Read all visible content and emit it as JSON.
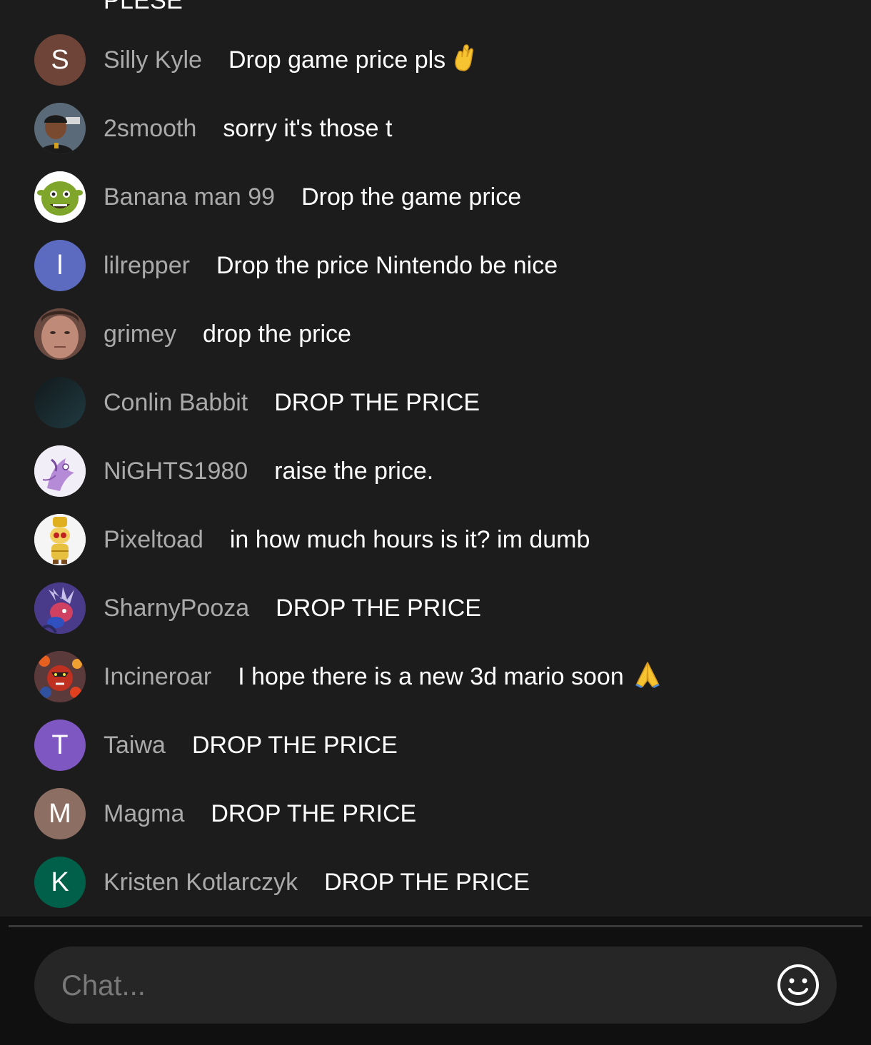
{
  "partial_top_message": "PLESE",
  "messages": [
    {
      "author": "Silly Kyle",
      "text": "Drop game price pls",
      "emoji": "crossed-fingers-icon",
      "avatar_letter": "S",
      "avatar_color": "#6d4437"
    },
    {
      "author": "2smooth",
      "text": "sorry it's those t",
      "avatar_letter": "",
      "avatar_color": "#3d3d3d"
    },
    {
      "author": "Banana man 99",
      "text": "Drop the game price",
      "avatar_letter": "",
      "avatar_color": "#6a8d1e"
    },
    {
      "author": "lilrepper",
      "text": "Drop the price Nintendo be nice",
      "avatar_letter": "l",
      "avatar_color": "#5c6bc0"
    },
    {
      "author": "grimey",
      "text": "drop the price",
      "avatar_letter": "",
      "avatar_color": "#9c6a5a"
    },
    {
      "author": "Conlin Babbit",
      "text": "DROP THE PRICE",
      "avatar_letter": "",
      "avatar_color": "#1b2b30"
    },
    {
      "author": "NiGHTS1980",
      "text": "raise the price.",
      "avatar_letter": "",
      "avatar_color": "#f2eef8"
    },
    {
      "author": "Pixeltoad",
      "text": "in how much hours is it? im dumb",
      "avatar_letter": "",
      "avatar_color": "#f5f5f5"
    },
    {
      "author": "SharnyPooza",
      "text": "DROP THE PRICE",
      "avatar_letter": "",
      "avatar_color": "#4a3a8a"
    },
    {
      "author": "Incineroar",
      "text": "I hope there is a new 3d mario soon",
      "emoji": "folded-hands-icon",
      "avatar_letter": "",
      "avatar_color": "#7a2a1e"
    },
    {
      "author": "Taiwa",
      "text": "DROP THE PRICE",
      "avatar_letter": "T",
      "avatar_color": "#7e57c2"
    },
    {
      "author": "Magma",
      "text": "DROP THE PRICE",
      "avatar_letter": "M",
      "avatar_color": "#8d6e63"
    },
    {
      "author": "Kristen Kotlarczyk",
      "text": "DROP THE PRICE",
      "avatar_letter": "K",
      "avatar_color": "#00604a"
    }
  ],
  "composer": {
    "placeholder": "Chat...",
    "emoji_button_icon": "smiley-face-icon"
  },
  "colors": {
    "background": "#1c1c1c",
    "author_text": "#aaaaaa",
    "message_text": "#ffffff",
    "input_background": "#262626"
  }
}
